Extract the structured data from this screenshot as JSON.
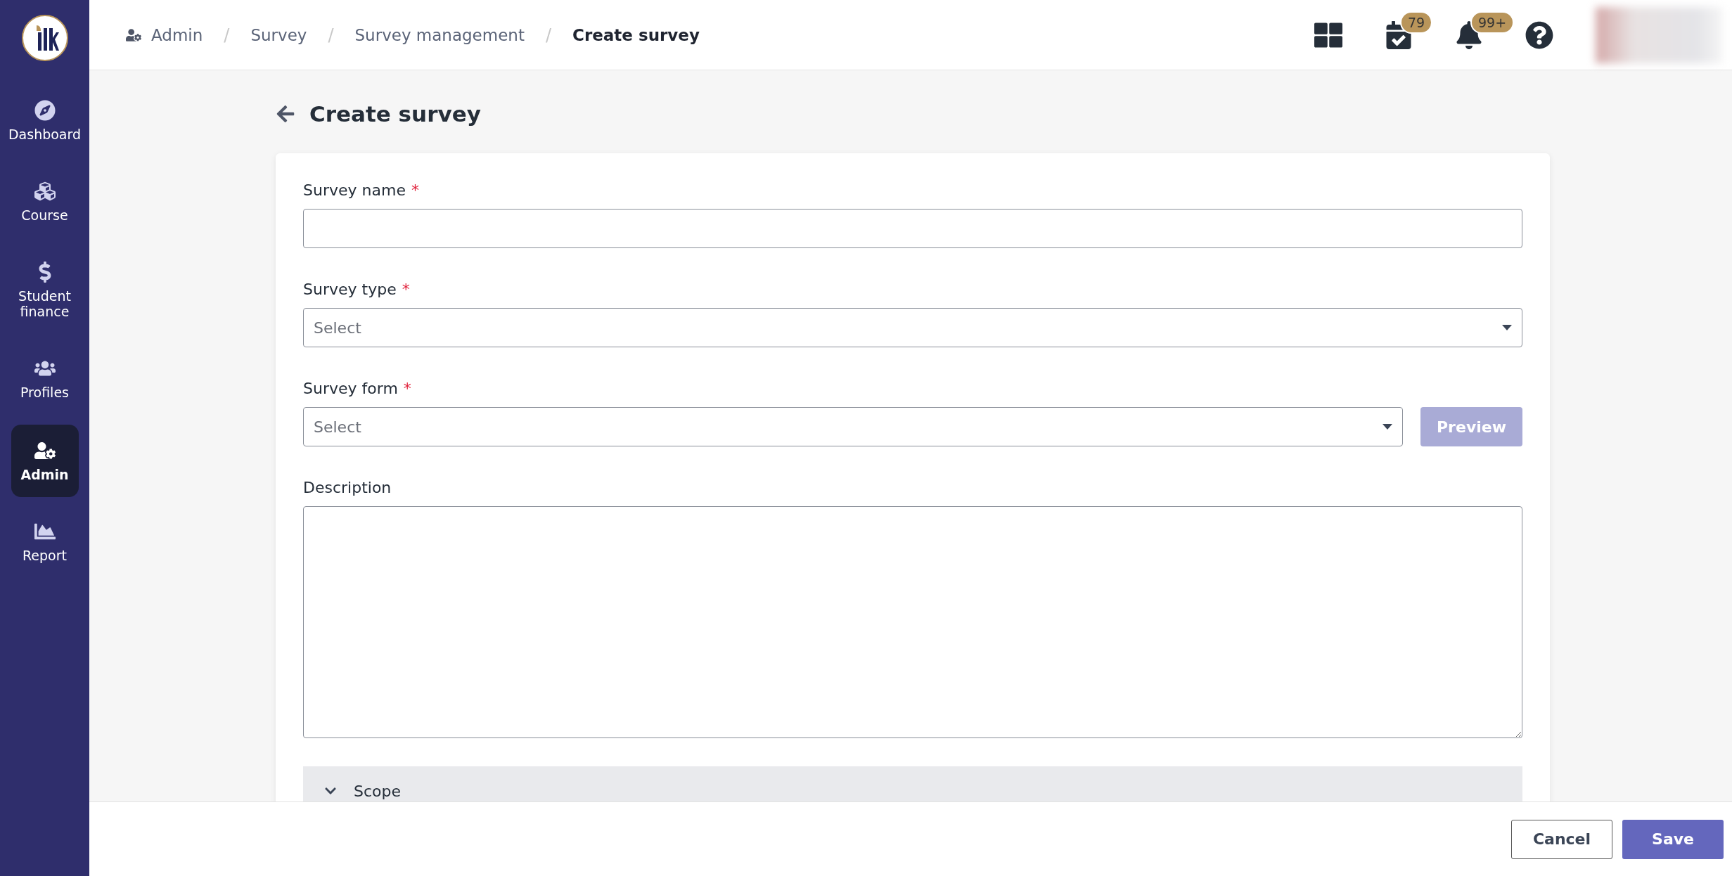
{
  "sidebar": {
    "items": [
      {
        "label": "Dashboard",
        "selected": false
      },
      {
        "label": "Course",
        "selected": false
      },
      {
        "label": "Student finance",
        "selected": false
      },
      {
        "label": "Profiles",
        "selected": false
      },
      {
        "label": "Admin",
        "selected": true
      },
      {
        "label": "Report",
        "selected": false
      }
    ]
  },
  "breadcrumb": [
    {
      "kind": "link",
      "label": "Admin"
    },
    {
      "kind": "separator",
      "label": "/"
    },
    {
      "kind": "link",
      "label": "Survey"
    },
    {
      "kind": "separator",
      "label": "/"
    },
    {
      "kind": "link",
      "label": "Survey management"
    },
    {
      "kind": "separator",
      "label": "/"
    },
    {
      "kind": "current",
      "label": "Create survey"
    }
  ],
  "topbar": {
    "tasks_badge": "79",
    "notifications_badge": "99+"
  },
  "page_title": "Create survey",
  "fields": [
    {
      "kind": "text",
      "label": "Survey name",
      "required_mark": "*"
    },
    {
      "kind": "select",
      "label": "Survey type",
      "required_mark": "*",
      "placeholder": "Select"
    },
    {
      "kind": "select",
      "label": "Survey form",
      "required_mark": "*",
      "placeholder": "Select",
      "action": {
        "label": "Preview",
        "disabled": true
      }
    },
    {
      "kind": "textarea",
      "label": "Description"
    }
  ],
  "sections": [
    {
      "title": "Scope",
      "expanded": true
    }
  ],
  "footer": {
    "buttons": [
      {
        "label": "Cancel",
        "kind": "secondary"
      },
      {
        "label": "Save",
        "kind": "primary"
      }
    ]
  }
}
